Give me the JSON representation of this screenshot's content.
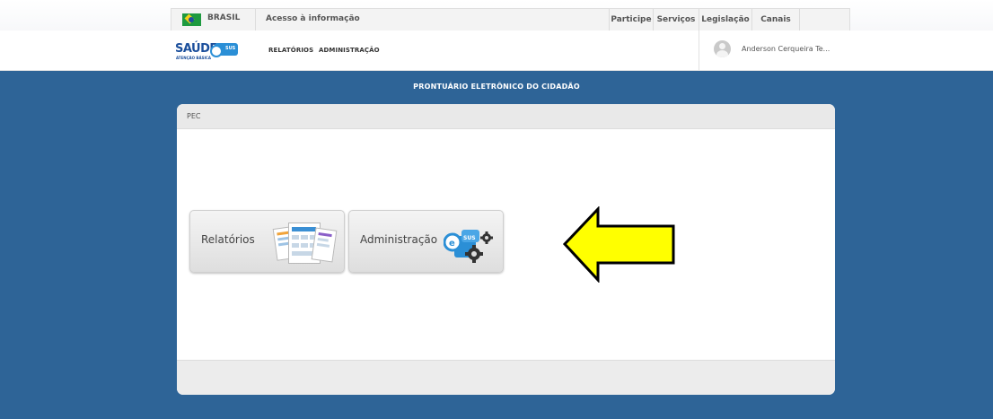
{
  "gov_bar": {
    "country": "BRASIL",
    "access_link": "Acesso à informação",
    "links": [
      {
        "label": "Participe",
        "width": 48
      },
      {
        "label": "Serviços",
        "width": 50
      },
      {
        "label": "Legislação",
        "width": 58
      },
      {
        "label": "Canais",
        "width": 52
      }
    ]
  },
  "header": {
    "logo_text": "SAÚDE",
    "logo_badge": "SUS",
    "logo_subtext": "ATENÇÃO BÁSICA",
    "nav": [
      {
        "label": "RELATÓRIOS"
      },
      {
        "label": "ADMINISTRAÇÃO"
      }
    ],
    "user_name": "Anderson Cerqueira Te..."
  },
  "main": {
    "page_title": "PRONTUÁRIO ELETRÔNICO DO CIDADÃO",
    "panel_title": "PEC",
    "tiles": [
      {
        "label": "Relatórios",
        "icon": "reports-icon"
      },
      {
        "label": "Administração",
        "icon": "esus-admin-icon"
      }
    ]
  },
  "annotation": {
    "icon": "yellow-arrow-icon",
    "fill": "#ffff00",
    "stroke": "#000000"
  },
  "colors": {
    "main_background": "#2e6497",
    "brand_blue": "#1b4f9c",
    "accent_blue": "#2b8fd6"
  }
}
